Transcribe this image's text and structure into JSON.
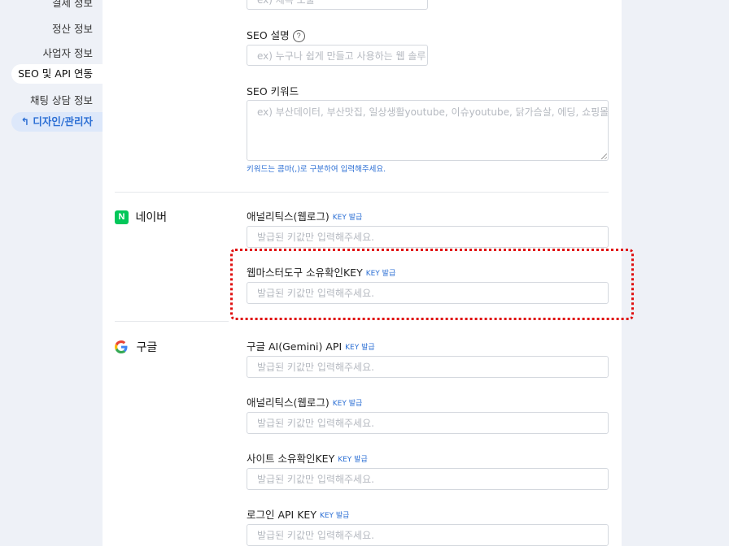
{
  "sidebar": {
    "items": [
      {
        "label": "결제 정보"
      },
      {
        "label": "정산 정보"
      },
      {
        "label": "사업자 정보"
      },
      {
        "label": "SEO 및 API 연동"
      },
      {
        "label": "채팅 상담 정보"
      }
    ],
    "design_link": {
      "icon": "↰",
      "label": "디자인/관리자"
    }
  },
  "seo": {
    "top_placeholder": "ex) 제목 노출",
    "description_label": "SEO 설명",
    "description_help": "?",
    "description_placeholder": "ex) 누구나 쉽게 만들고 사용하는 웹 솔루",
    "keywords_label": "SEO 키워드",
    "keywords_placeholder": "ex) 부산데이터, 부산맛집, 일상생활youtube, 이슈youtube, 닭가슴살, 에딩, 쇼핑몰",
    "keywords_hint": "키워드는 콤마(,)로 구분하여 입력해주세요."
  },
  "naver": {
    "logo_text": "N",
    "title": "네이버",
    "fields": [
      {
        "label": "애널리틱스(웹로그)",
        "key_link": "KEY 발급",
        "placeholder": "발급된 키값만 입력해주세요."
      },
      {
        "label": "웹마스터도구 소유확인KEY",
        "key_link": "KEY 발급",
        "placeholder": "발급된 키값만 입력해주세요."
      }
    ]
  },
  "google": {
    "title": "구글",
    "fields": [
      {
        "label": "구글 AI(Gemini) API",
        "key_link": "KEY 발급",
        "placeholder": "발급된 키값만 입력해주세요."
      },
      {
        "label": "애널리틱스(웹로그)",
        "key_link": "KEY 발급",
        "placeholder": "발급된 키값만 입력해주세요."
      },
      {
        "label": "사이트 소유확인KEY",
        "key_link": "KEY 발급",
        "placeholder": "발급된 키값만 입력해주세요."
      },
      {
        "label": "로그인 API KEY",
        "key_link": "KEY 발급",
        "placeholder": "발급된 키값만 입력해주세요."
      }
    ]
  },
  "colors": {
    "accent": "#2c6fd4",
    "naver_green": "#03c75a",
    "highlight_red": "#e01010",
    "background": "#eef1f7"
  }
}
